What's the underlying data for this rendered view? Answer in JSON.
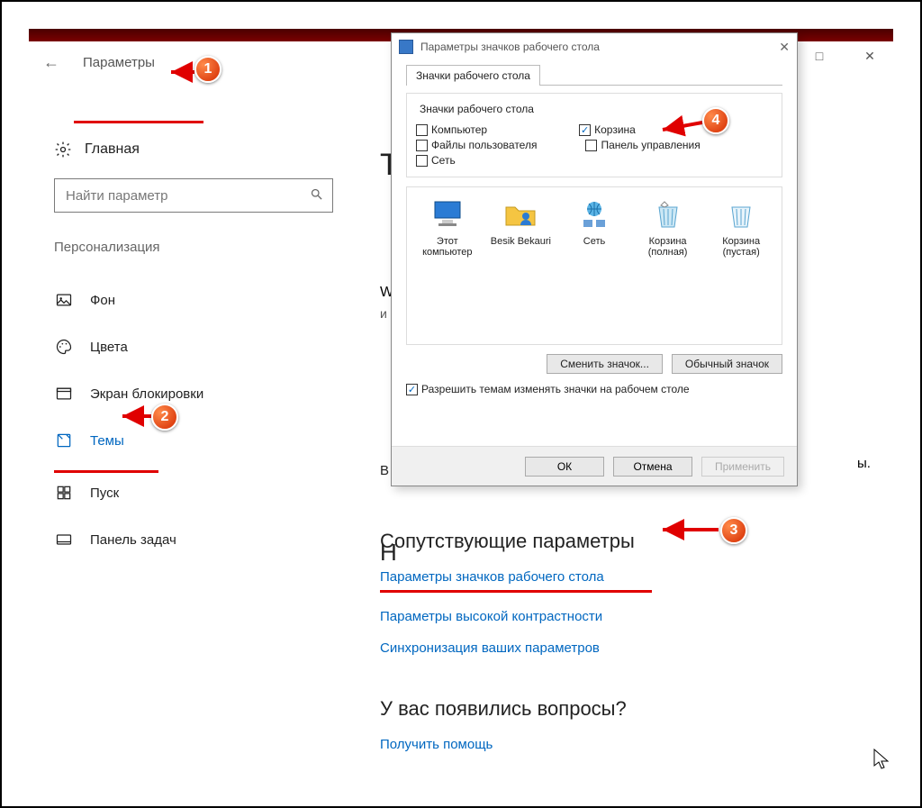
{
  "settings": {
    "title": "Параметры",
    "home": "Главная",
    "search_placeholder": "Найти параметр",
    "category": "Персонализация",
    "nav": {
      "background": "Фон",
      "colors": "Цвета",
      "lockscreen": "Экран блокировки",
      "themes": "Темы",
      "start": "Пуск",
      "taskbar": "Панель задач"
    }
  },
  "main": {
    "t": "Т",
    "w": "W",
    "i": "и",
    "n": "Н",
    "b": "В",
    "tail_text": "ы.",
    "related_heading": "Сопутствующие параметры",
    "links": {
      "desktop_icons": "Параметры значков рабочего стола",
      "high_contrast": "Параметры высокой контрастности",
      "sync": "Синхронизация ваших параметров"
    },
    "question_heading": "У вас появились вопросы?",
    "help_link": "Получить помощь"
  },
  "dialog": {
    "title": "Параметры значков рабочего стола",
    "tab": "Значки рабочего стола",
    "group_title": "Значки рабочего стола",
    "chk": {
      "computer": "Компьютер",
      "recycle": "Корзина",
      "user_files": "Файлы пользователя",
      "control_panel": "Панель управления",
      "network": "Сеть"
    },
    "icons": {
      "this_pc": "Этот компьютер",
      "user": "Besik Bekauri",
      "network": "Сеть",
      "bin_full": "Корзина (полная)",
      "bin_empty": "Корзина (пустая)"
    },
    "btn_change": "Сменить значок...",
    "btn_default": "Обычный значок",
    "allow_themes": "Разрешить темам изменять значки на рабочем столе",
    "ok": "ОК",
    "cancel": "Отмена",
    "apply": "Применить"
  },
  "badges": {
    "1": "1",
    "2": "2",
    "3": "3",
    "4": "4"
  }
}
